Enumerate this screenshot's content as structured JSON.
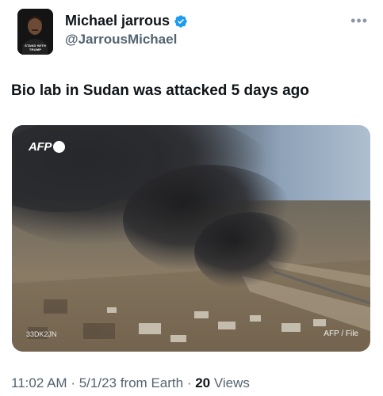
{
  "author": {
    "display_name": "Michael jarrous",
    "handle": "@JarrousMichael",
    "verified": true,
    "avatar_caption": "STAND WITH TRUMP"
  },
  "tweet": {
    "text": "Bio lab in Sudan was attacked 5 days ago"
  },
  "media": {
    "logo": "AFP",
    "code": "33DK2JN",
    "credit": "AFP / File"
  },
  "meta": {
    "time": "11:02 AM",
    "date": "5/1/23",
    "source": "from Earth",
    "views_count": "20",
    "views_label": "Views"
  },
  "colors": {
    "verified_blue": "#1d9bf0",
    "secondary_text": "#536471"
  },
  "icons": [
    "verified-badge-icon",
    "more-options-icon",
    "afp-dot-icon"
  ]
}
